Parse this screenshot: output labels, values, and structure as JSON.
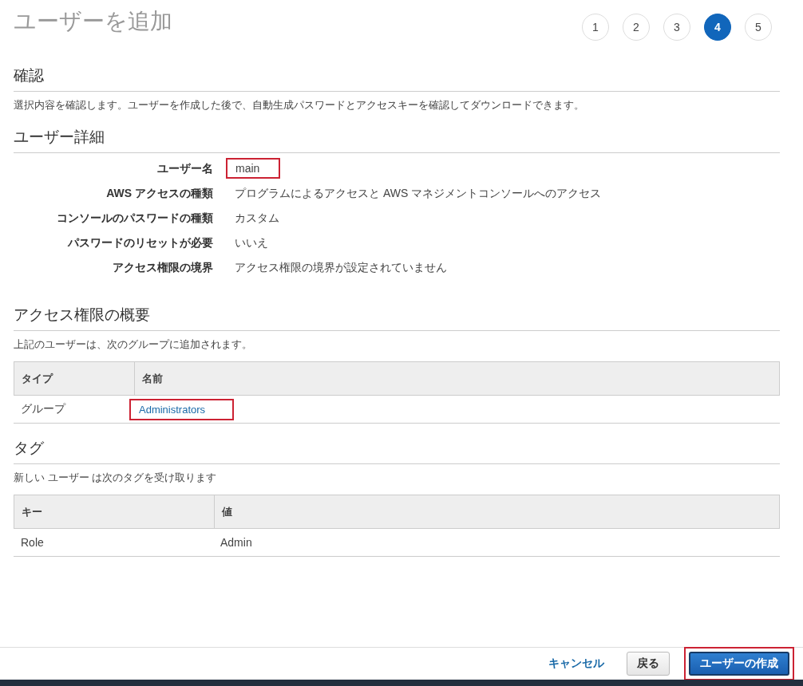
{
  "title": "ユーザーを追加",
  "steps": [
    {
      "label": "1",
      "selected": false
    },
    {
      "label": "2",
      "selected": false
    },
    {
      "label": "3",
      "selected": false
    },
    {
      "label": "4",
      "selected": true
    },
    {
      "label": "5",
      "selected": false
    }
  ],
  "review": {
    "heading": "確認",
    "description": "選択内容を確認します。ユーザーを作成した後で、自動生成パスワードとアクセスキーを確認してダウンロードできます。"
  },
  "user_details": {
    "heading": "ユーザー詳細",
    "rows": [
      {
        "label": "ユーザー名",
        "value": "main",
        "highlighted": true
      },
      {
        "label": "AWS アクセスの種類",
        "value": "プログラムによるアクセスと AWS マネジメントコンソールへのアクセス",
        "highlighted": false
      },
      {
        "label": "コンソールのパスワードの種類",
        "value": "カスタム",
        "highlighted": false
      },
      {
        "label": "パスワードのリセットが必要",
        "value": "いいえ",
        "highlighted": false
      },
      {
        "label": "アクセス権限の境界",
        "value": "アクセス権限の境界が設定されていません",
        "highlighted": false
      }
    ]
  },
  "permissions": {
    "heading": "アクセス権限の概要",
    "description": "上記のユーザーは、次のグループに追加されます。",
    "table": {
      "columns": [
        "タイプ",
        "名前"
      ],
      "rows": [
        [
          {
            "text": "グループ",
            "kind": "text",
            "highlighted": false
          },
          {
            "text": "Administrators",
            "kind": "link",
            "highlighted": true
          }
        ]
      ]
    }
  },
  "tags": {
    "heading": "タグ",
    "description": "新しい ユーザー は次のタグを受け取ります",
    "table": {
      "columns": [
        "キー",
        "値"
      ],
      "rows": [
        [
          {
            "text": "Role",
            "kind": "text",
            "highlighted": false
          },
          {
            "text": "Admin",
            "kind": "text",
            "highlighted": false
          }
        ]
      ]
    }
  },
  "footer": {
    "buttons": [
      {
        "label": "キャンセル",
        "kind": "link"
      },
      {
        "label": "戻る",
        "kind": "secondary"
      },
      {
        "label": "ユーザーの作成",
        "kind": "primary",
        "highlighted": true
      }
    ]
  }
}
